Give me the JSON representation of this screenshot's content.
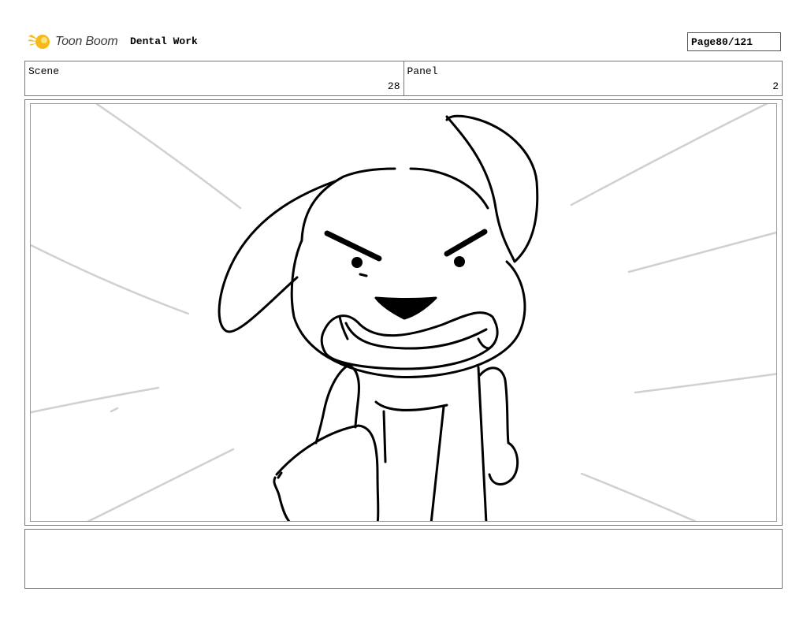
{
  "header": {
    "logo_text": "Toon Boom",
    "project_title": "Dental Work",
    "page_label": "Page",
    "page_value": "80/121"
  },
  "info": {
    "scene_label": "Scene",
    "scene_value": "28",
    "panel_label": "Panel",
    "panel_value": "2"
  },
  "notes": {
    "text": ""
  },
  "colors": {
    "logo_star": "#f5b91a",
    "logo_text": "#3a3a3a",
    "speed_lines": "#d0d0d0",
    "ink": "#000000"
  },
  "icons": {
    "logo": "toon-boom-star-icon"
  }
}
